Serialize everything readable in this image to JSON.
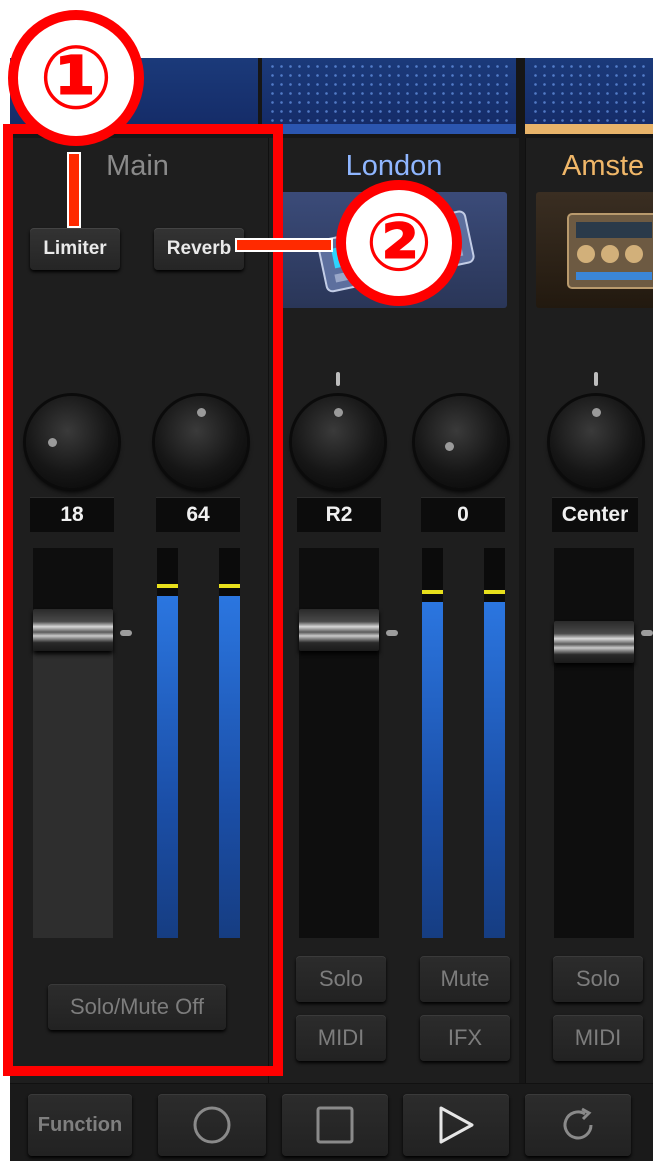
{
  "channels": [
    {
      "name": "Main",
      "label_color": "#8a8a8a",
      "buttons": [
        "Limiter",
        "Reverb"
      ],
      "values": [
        "18",
        "64"
      ],
      "footer": "Solo/Mute Off"
    },
    {
      "name": "London",
      "label_color": "#8fb6ff",
      "values": [
        "R2",
        "0"
      ],
      "buttons_row1": [
        "Solo",
        "Mute"
      ],
      "buttons_row2": [
        "MIDI",
        "IFX"
      ]
    },
    {
      "name": "Amste",
      "label_color": "#f0b769",
      "values": [
        "Center"
      ],
      "buttons_row1": [
        "Solo"
      ],
      "buttons_row2": [
        "MIDI"
      ]
    }
  ],
  "toolbar": {
    "function_label": "Function",
    "icons": [
      "record-circle-icon",
      "stop-square-icon",
      "play-triangle-icon",
      "loop-refresh-icon"
    ]
  },
  "annotations": {
    "one": "①",
    "two": "②",
    "annotation_color": "#ff0000"
  },
  "colors": {
    "meter_blue": "#2b76e0",
    "peak_yellow": "#e8e01c"
  }
}
